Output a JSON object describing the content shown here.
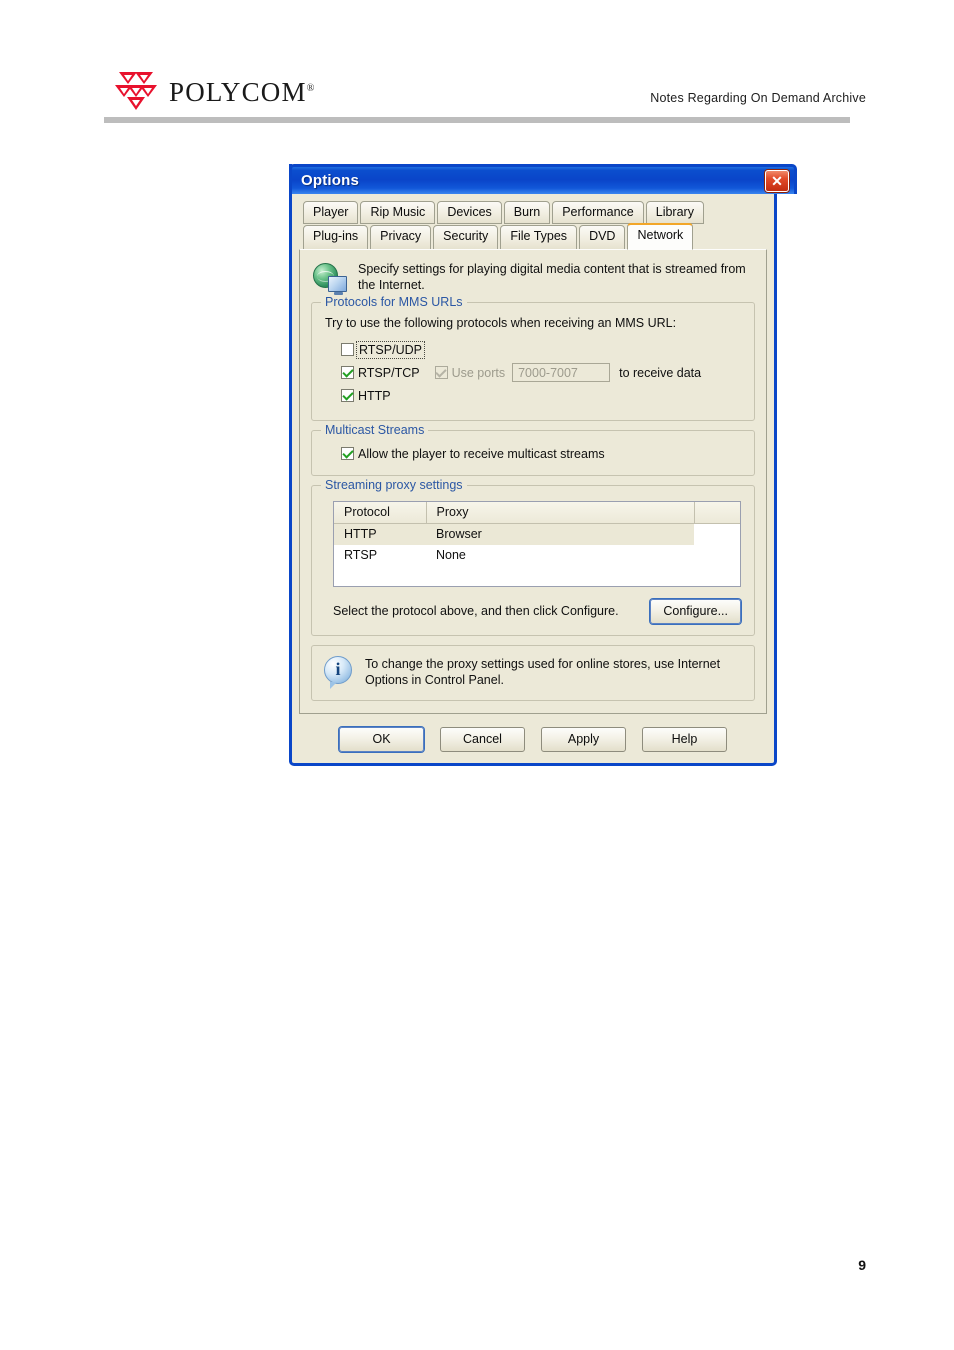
{
  "page": {
    "brand": "POLYCOM",
    "brand_trademark": "®",
    "header_title": "Notes Regarding On Demand Archive",
    "page_number": "9"
  },
  "dialog": {
    "title": "Options",
    "close_label": "✕",
    "tabs_row1": [
      {
        "label": "Player",
        "selected": false
      },
      {
        "label": "Rip Music",
        "selected": false
      },
      {
        "label": "Devices",
        "selected": false
      },
      {
        "label": "Burn",
        "selected": false
      },
      {
        "label": "Performance",
        "selected": false
      },
      {
        "label": "Library",
        "selected": false
      }
    ],
    "tabs_row2": [
      {
        "label": "Plug-ins",
        "selected": false
      },
      {
        "label": "Privacy",
        "selected": false
      },
      {
        "label": "Security",
        "selected": false
      },
      {
        "label": "File Types",
        "selected": false
      },
      {
        "label": "DVD",
        "selected": false
      },
      {
        "label": "Network",
        "selected": true
      }
    ],
    "intro": {
      "text": "Specify settings for playing digital media content that is streamed from the Internet.",
      "icon": "globe-network-icon"
    },
    "protocols_group": {
      "title": "Protocols for MMS URLs",
      "lead": "Try to use the following protocols when receiving an MMS URL:",
      "items": [
        {
          "label": "RTSP/UDP",
          "checked": false,
          "focused": true
        },
        {
          "label": "RTSP/TCP",
          "checked": true,
          "focused": false
        },
        {
          "label": "HTTP",
          "checked": true,
          "focused": false
        }
      ],
      "use_ports": {
        "label": "Use ports",
        "checked": true,
        "disabled": true,
        "value": "7000-7007",
        "suffix": "to receive data"
      }
    },
    "multicast_group": {
      "title": "Multicast Streams",
      "checkbox": {
        "label": "Allow the player to receive multicast streams",
        "checked": true
      }
    },
    "proxy_group": {
      "title": "Streaming proxy settings",
      "columns": [
        "Protocol",
        "Proxy",
        ""
      ],
      "rows": [
        {
          "protocol": "HTTP",
          "proxy": "Browser",
          "selected": true
        },
        {
          "protocol": "RTSP",
          "proxy": "None",
          "selected": false
        }
      ],
      "hint": "Select the protocol above, and then click Configure.",
      "configure_label": "Configure..."
    },
    "note": {
      "icon": "info-icon",
      "text": "To change the proxy settings used for online stores, use Internet Options in Control Panel."
    },
    "footer_buttons": [
      {
        "label": "OK",
        "default": true
      },
      {
        "label": "Cancel",
        "default": false
      },
      {
        "label": "Apply",
        "default": false
      },
      {
        "label": "Help",
        "default": false
      }
    ]
  },
  "colors": {
    "titlebar_blue": "#0a46c8",
    "dialog_face": "#ece9d8",
    "group_title_blue": "#2b57a4",
    "tab_accent_orange": "#f2a628",
    "brand_red": "#e8112d",
    "check_green": "#22a022",
    "selected_row": "#ebe8d6"
  }
}
